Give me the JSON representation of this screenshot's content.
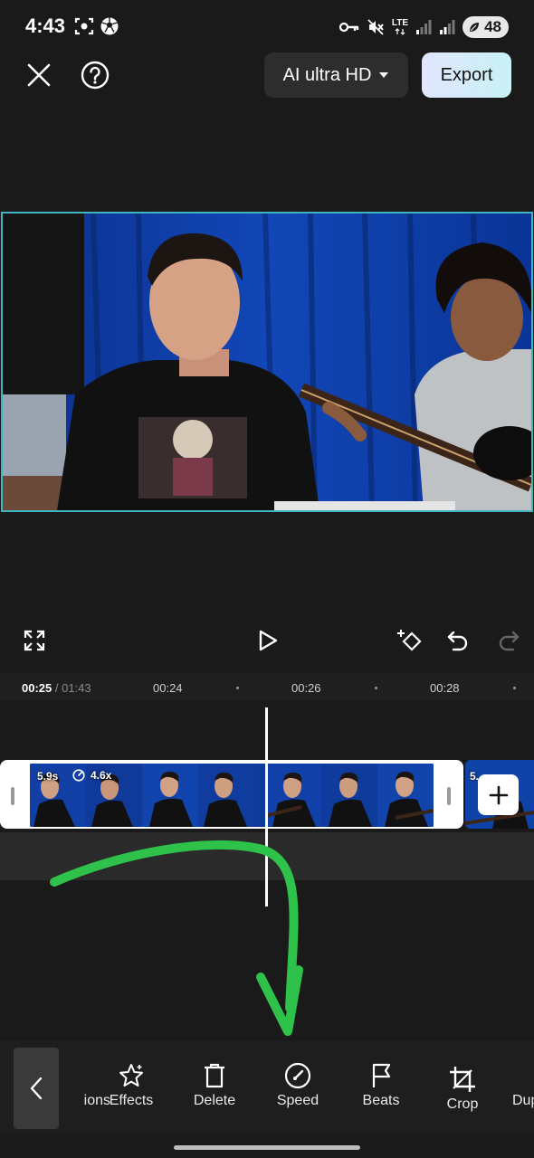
{
  "status_bar": {
    "time": "4:43",
    "network": "LTE",
    "battery": "48"
  },
  "top_bar": {
    "quality_label": "AI ultra HD",
    "export_label": "Export"
  },
  "timeline": {
    "current_time": "00:25",
    "separator": " / ",
    "total_time": "01:43",
    "ticks": [
      "00:24",
      "00:26",
      "00:28"
    ],
    "clip_duration": "5.9s",
    "clip_speed": "4.6x",
    "next_clip_duration": "5."
  },
  "toolbar": {
    "items": [
      {
        "label": "ions",
        "icon": "animations-icon"
      },
      {
        "label": "Effects",
        "icon": "effects-star-icon"
      },
      {
        "label": "Delete",
        "icon": "delete-trash-icon"
      },
      {
        "label": "Speed",
        "icon": "speed-gauge-icon"
      },
      {
        "label": "Beats",
        "icon": "beats-flag-icon"
      },
      {
        "label": "Crop",
        "icon": "crop-icon"
      },
      {
        "label": "Dup",
        "icon": "duplicate-icon"
      }
    ]
  },
  "colors": {
    "selection_border": "#3fb6c2",
    "annotation_arrow": "#2ec24a",
    "export_gradient_start": "#e2e5ff",
    "export_gradient_end": "#c8f2f6"
  }
}
